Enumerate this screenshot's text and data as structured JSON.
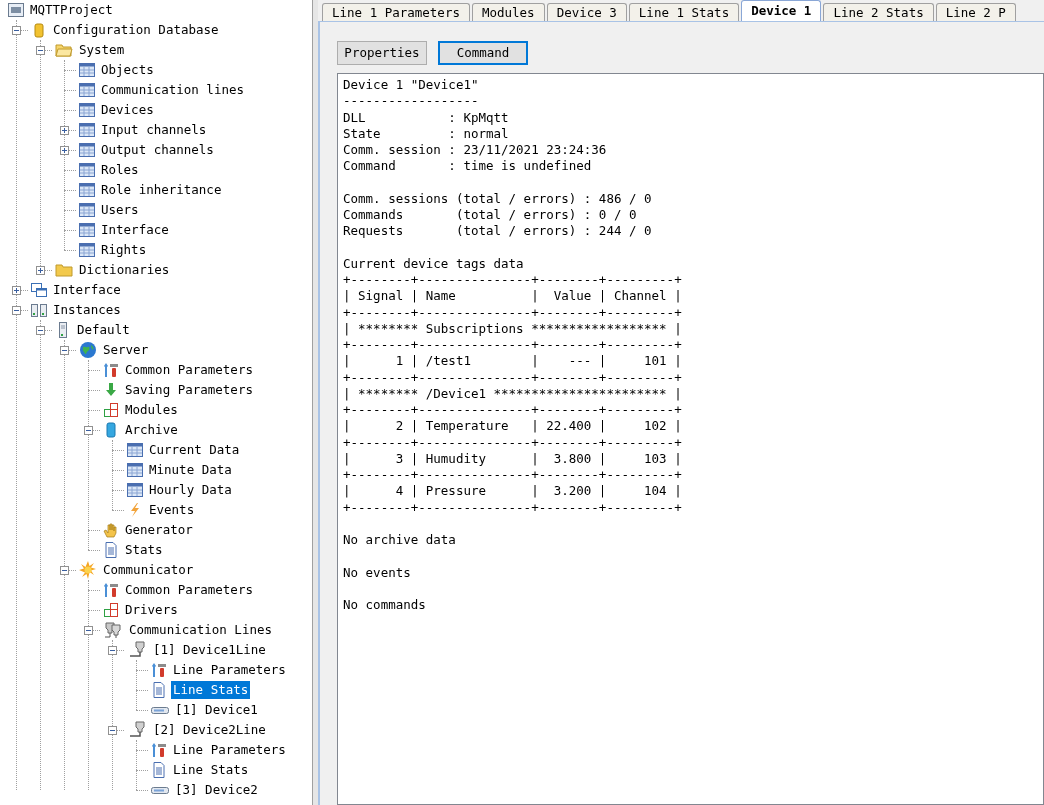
{
  "tree": {
    "label": "MQTTProject",
    "kind": "project",
    "selected": false,
    "children": [
      {
        "label": "Configuration Database",
        "kind": "database",
        "expanded": true,
        "selected": false,
        "children": [
          {
            "label": "System",
            "kind": "folder-open",
            "expanded": true,
            "selected": false,
            "children": [
              {
                "label": "Objects",
                "kind": "table",
                "selected": false
              },
              {
                "label": "Communication lines",
                "kind": "table",
                "selected": false
              },
              {
                "label": "Devices",
                "kind": "table",
                "selected": false
              },
              {
                "label": "Input channels",
                "kind": "table",
                "expanded": false,
                "selected": false
              },
              {
                "label": "Output channels",
                "kind": "table",
                "expanded": false,
                "selected": false
              },
              {
                "label": "Roles",
                "kind": "table",
                "selected": false
              },
              {
                "label": "Role inheritance",
                "kind": "table",
                "selected": false
              },
              {
                "label": "Users",
                "kind": "table",
                "selected": false
              },
              {
                "label": "Interface",
                "kind": "table",
                "selected": false
              },
              {
                "label": "Rights",
                "kind": "table",
                "selected": false
              }
            ]
          },
          {
            "label": "Dictionaries",
            "kind": "folder",
            "expanded": false,
            "selected": false
          }
        ]
      },
      {
        "label": "Interface",
        "kind": "windows",
        "expanded": false,
        "selected": false
      },
      {
        "label": "Instances",
        "kind": "instances",
        "expanded": true,
        "selected": false,
        "children": [
          {
            "label": "Default",
            "kind": "server",
            "expanded": true,
            "selected": false,
            "children": [
              {
                "label": "Server",
                "kind": "globe",
                "expanded": true,
                "selected": false,
                "children": [
                  {
                    "label": "Common Parameters",
                    "kind": "tools",
                    "selected": false
                  },
                  {
                    "label": "Saving Parameters",
                    "kind": "save",
                    "selected": false
                  },
                  {
                    "label": "Modules",
                    "kind": "modules",
                    "selected": false
                  },
                  {
                    "label": "Archive",
                    "kind": "archive",
                    "expanded": true,
                    "selected": false,
                    "children": [
                      {
                        "label": "Current Data",
                        "kind": "table",
                        "selected": false
                      },
                      {
                        "label": "Minute Data",
                        "kind": "table",
                        "selected": false
                      },
                      {
                        "label": "Hourly Data",
                        "kind": "table",
                        "selected": false
                      },
                      {
                        "label": "Events",
                        "kind": "lightning",
                        "selected": false
                      }
                    ]
                  },
                  {
                    "label": "Generator",
                    "kind": "hand",
                    "selected": false
                  },
                  {
                    "label": "Stats",
                    "kind": "document",
                    "selected": false
                  }
                ]
              },
              {
                "label": "Communicator",
                "kind": "sun",
                "expanded": true,
                "selected": false,
                "children": [
                  {
                    "label": "Common Parameters",
                    "kind": "tools",
                    "selected": false
                  },
                  {
                    "label": "Drivers",
                    "kind": "modules",
                    "selected": false
                  },
                  {
                    "label": "Communication Lines",
                    "kind": "lines",
                    "expanded": true,
                    "selected": false,
                    "children": [
                      {
                        "label": "[1] Device1Line",
                        "kind": "line",
                        "expanded": true,
                        "selected": false,
                        "children": [
                          {
                            "label": "Line Parameters",
                            "kind": "tools",
                            "selected": false
                          },
                          {
                            "label": "Line Stats",
                            "kind": "document",
                            "selected": true
                          },
                          {
                            "label": "[1] Device1",
                            "kind": "device",
                            "selected": false
                          }
                        ]
                      },
                      {
                        "label": "[2] Device2Line",
                        "kind": "line",
                        "expanded": true,
                        "selected": false,
                        "children": [
                          {
                            "label": "Line Parameters",
                            "kind": "tools",
                            "selected": false
                          },
                          {
                            "label": "Line Stats",
                            "kind": "document",
                            "selected": false
                          },
                          {
                            "label": "[3] Device2",
                            "kind": "device",
                            "selected": false
                          }
                        ]
                      }
                    ]
                  }
                ]
              }
            ]
          }
        ]
      }
    ]
  },
  "tabs": [
    {
      "label": "Line 1 Parameters",
      "selected": false
    },
    {
      "label": "Modules",
      "selected": false
    },
    {
      "label": "Device 3",
      "selected": false
    },
    {
      "label": "Line 1 Stats",
      "selected": false
    },
    {
      "label": "Device 1",
      "selected": true
    },
    {
      "label": "Line 2 Stats",
      "selected": false
    },
    {
      "label": "Line 2 P",
      "selected": false
    }
  ],
  "view_buttons": [
    {
      "label": "Properties",
      "selected": false
    },
    {
      "label": "Command",
      "selected": true
    }
  ],
  "output_blocks": [
    [
      "Device 1 \"Device1\"",
      "------------------",
      "DLL           : KpMqtt",
      "State         : normal",
      "Comm. session : 23/11/2021 23:24:36",
      "Command       : time is undefined"
    ],
    [
      "Comm. sessions (total / errors) : 486 / 0",
      "Commands       (total / errors) : 0 / 0",
      "Requests       (total / errors) : 244 / 0"
    ],
    [
      "Current device tags data",
      "+--------+---------------+--------+---------+",
      "| Signal | Name          |  Value | Channel |",
      "+--------+---------------+--------+---------+",
      "| ******** Subscriptions ****************** |",
      "+--------+---------------+--------+---------+",
      "|      1 | /test1        |    --- |     101 |",
      "+--------+---------------+--------+---------+",
      "| ******** /Device1 *********************** |",
      "+--------+---------------+--------+---------+",
      "|      2 | Temperature   | 22.400 |     102 |",
      "+--------+---------------+--------+---------+",
      "|      3 | Humudity      |  3.800 |     103 |",
      "+--------+---------------+--------+---------+",
      "|      4 | Pressure      |  3.200 |     104 |",
      "+--------+---------------+--------+---------+"
    ],
    [
      "No archive data"
    ],
    [
      "No events"
    ],
    [
      "No commands"
    ]
  ]
}
